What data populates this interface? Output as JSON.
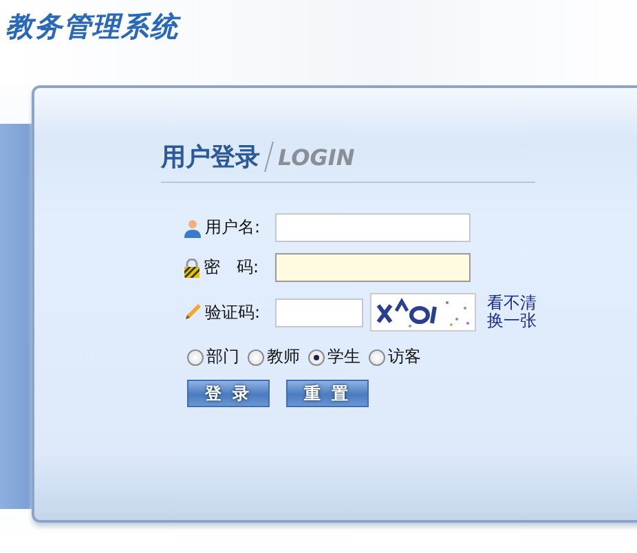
{
  "site_title": "教务管理系统",
  "heading": {
    "main": "用户登录",
    "sub": "LOGIN"
  },
  "fields": [
    {
      "kind": "user",
      "label": "用户名:",
      "focused": false
    },
    {
      "kind": "password",
      "label": "密　码:",
      "focused": true
    },
    {
      "kind": "captcha",
      "label": "验证码:",
      "focused": false,
      "refresh_link": "看不清换一张"
    }
  ],
  "roles": [
    {
      "label": "部门",
      "selected": false
    },
    {
      "label": "教师",
      "selected": false
    },
    {
      "label": "学生",
      "selected": true
    },
    {
      "label": "访客",
      "selected": false
    }
  ],
  "buttons": [
    "登 录",
    "重 置"
  ]
}
